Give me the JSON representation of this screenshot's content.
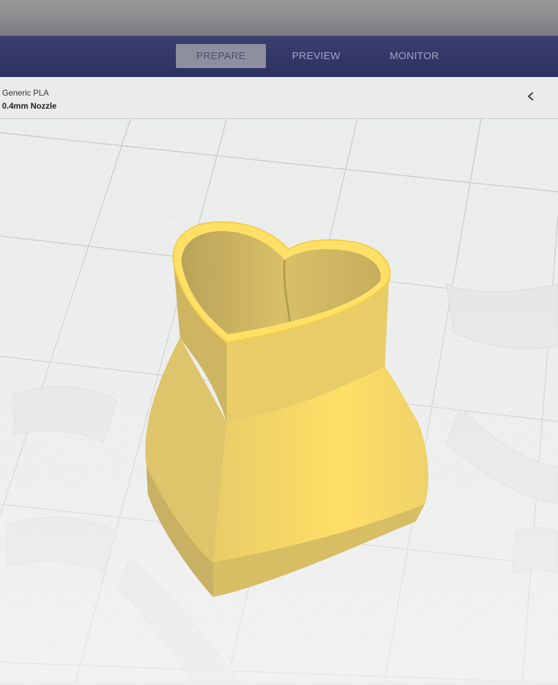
{
  "stages": {
    "prepare": "PREPARE",
    "preview": "PREVIEW",
    "monitor": "MONITOR",
    "active": "prepare"
  },
  "printer": {
    "material": "Generic PLA",
    "nozzle": "0.4mm Nozzle"
  },
  "icons": {
    "collapse": "chevron-left-icon"
  },
  "colors": {
    "stage_bar": "#2d3160",
    "model_fill": "#ffe066",
    "model_side": "#d8bf66",
    "build_plate": "#eceded"
  }
}
